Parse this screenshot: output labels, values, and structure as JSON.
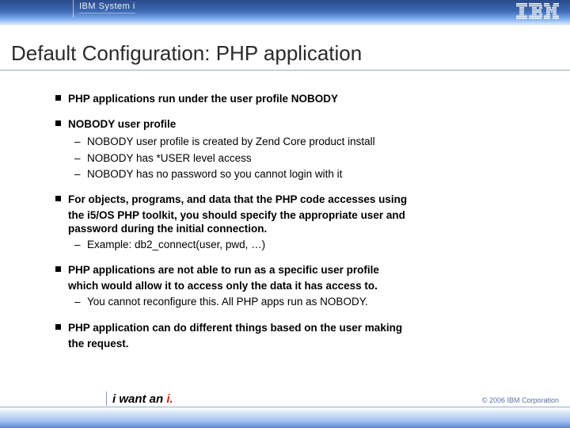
{
  "header": {
    "product": "IBM System i",
    "logo_text": "IBM"
  },
  "title": "Default Configuration: PHP application",
  "bullets": [
    {
      "level": 1,
      "text": "PHP applications run under the user profile NOBODY"
    },
    {
      "level": 1,
      "text": "NOBODY user profile"
    },
    {
      "level": 2,
      "text": "NOBODY user profile is created by Zend Core product install"
    },
    {
      "level": 2,
      "text": "NOBODY has *USER level access"
    },
    {
      "level": 2,
      "text": "NOBODY has no password so you cannot login with it"
    },
    {
      "level": 1,
      "text": "For objects, programs, and data that the PHP code accesses using"
    },
    {
      "level": 0,
      "text": "the i5/OS PHP toolkit, you should specify the appropriate user and"
    },
    {
      "level": 0,
      "text": "password during the initial connection."
    },
    {
      "level": 2,
      "text": "Example: db2_connect(user, pwd, …)"
    },
    {
      "level": 1,
      "text": "PHP applications are not able to run as a specific user profile"
    },
    {
      "level": 0,
      "text": "which would allow it to access only the data it has access to."
    },
    {
      "level": 2,
      "text": "You cannot reconfigure this. All PHP apps run as NOBODY."
    },
    {
      "level": 1,
      "text": "PHP application can do different things based on the user making"
    },
    {
      "level": 0,
      "text": "the request."
    }
  ],
  "footer": {
    "tagline_pre": "i want an ",
    "tagline_accent": "i.",
    "copyright": "© 2006 IBM Corporation"
  }
}
